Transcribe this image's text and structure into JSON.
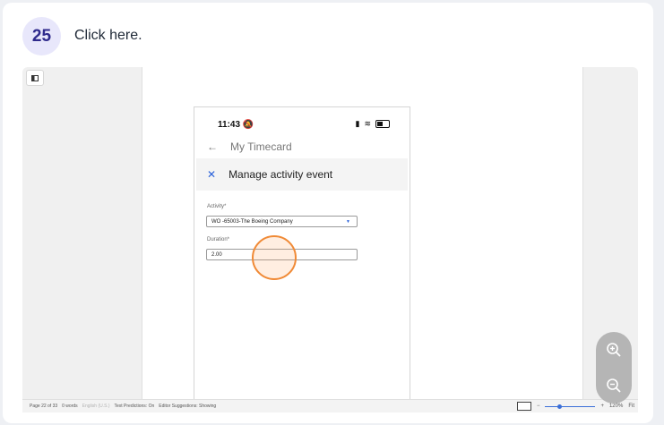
{
  "step": {
    "number": "25",
    "instruction": "Click here."
  },
  "phone": {
    "time": "11:43",
    "header_title": "My Timecard",
    "modal_title": "Manage activity event",
    "activity_label": "Activity*",
    "activity_value": "WO -65003-The Boeing Company",
    "duration_label": "Duration*",
    "duration_value": "2.00"
  },
  "statusbar": {
    "page": "Page 22 of 33",
    "words": "0 words",
    "language": "English (U.S.)",
    "predictions": "Text Predictions: On",
    "suggestions": "Editor Suggestions: Showing",
    "zoom": "120%",
    "fit": "Fit"
  },
  "colors": {
    "badge_bg": "#e8e7fb",
    "badge_text": "#2f2a8c",
    "click_highlight": "#f08a36",
    "accent_blue": "#2b62d9"
  },
  "icons": [
    "sidebar-toggle-icon",
    "bell-slash-icon",
    "signal-icon",
    "wifi-icon",
    "battery-icon",
    "back-arrow-icon",
    "close-icon",
    "dropdown-arrow-icon",
    "zoom-in-icon",
    "zoom-out-icon"
  ]
}
